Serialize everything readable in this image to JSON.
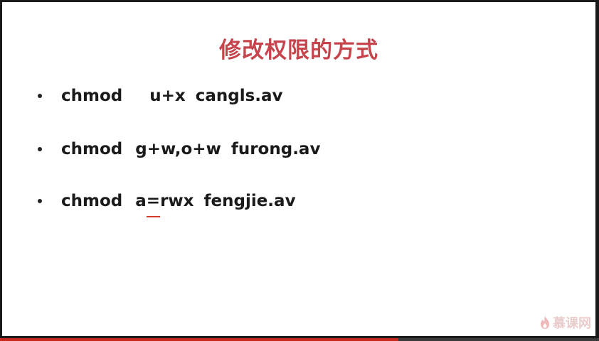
{
  "slide": {
    "title": "修改权限的方式",
    "commands": [
      {
        "cmd": "chmod",
        "mode": "u+x",
        "file": "cangls.av"
      },
      {
        "cmd": "chmod",
        "mode": "g+w,o+w",
        "file": "furong.av"
      },
      {
        "cmd": "chmod",
        "mode_a": "a",
        "mode_eq": "=",
        "mode_rest": "rwx",
        "file": "fengjie.av"
      }
    ]
  },
  "watermark": {
    "icon": "flame-icon",
    "text": "慕课网"
  },
  "progress": {
    "fraction": 0.665,
    "color": "#c8281e"
  },
  "colors": {
    "title": "#c6454c",
    "underline": "#d63a2a"
  }
}
